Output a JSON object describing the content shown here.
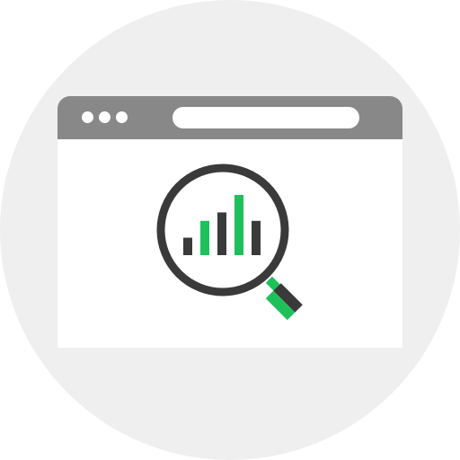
{
  "icon": {
    "name": "browser-analytics-search-icon",
    "colors": {
      "background_circle": "#efefef",
      "window_bar": "#888888",
      "window_body": "#ffffff",
      "dark": "#3a3a3a",
      "accent": "#1ec05a"
    },
    "window_controls": [
      "window-dot-1",
      "window-dot-2",
      "window-dot-3"
    ],
    "bars": [
      {
        "level": 0.29,
        "color": "dark"
      },
      {
        "level": 0.57,
        "color": "accent"
      },
      {
        "level": 0.71,
        "color": "dark"
      },
      {
        "level": 1.0,
        "color": "accent"
      },
      {
        "level": 0.57,
        "color": "dark"
      }
    ]
  }
}
